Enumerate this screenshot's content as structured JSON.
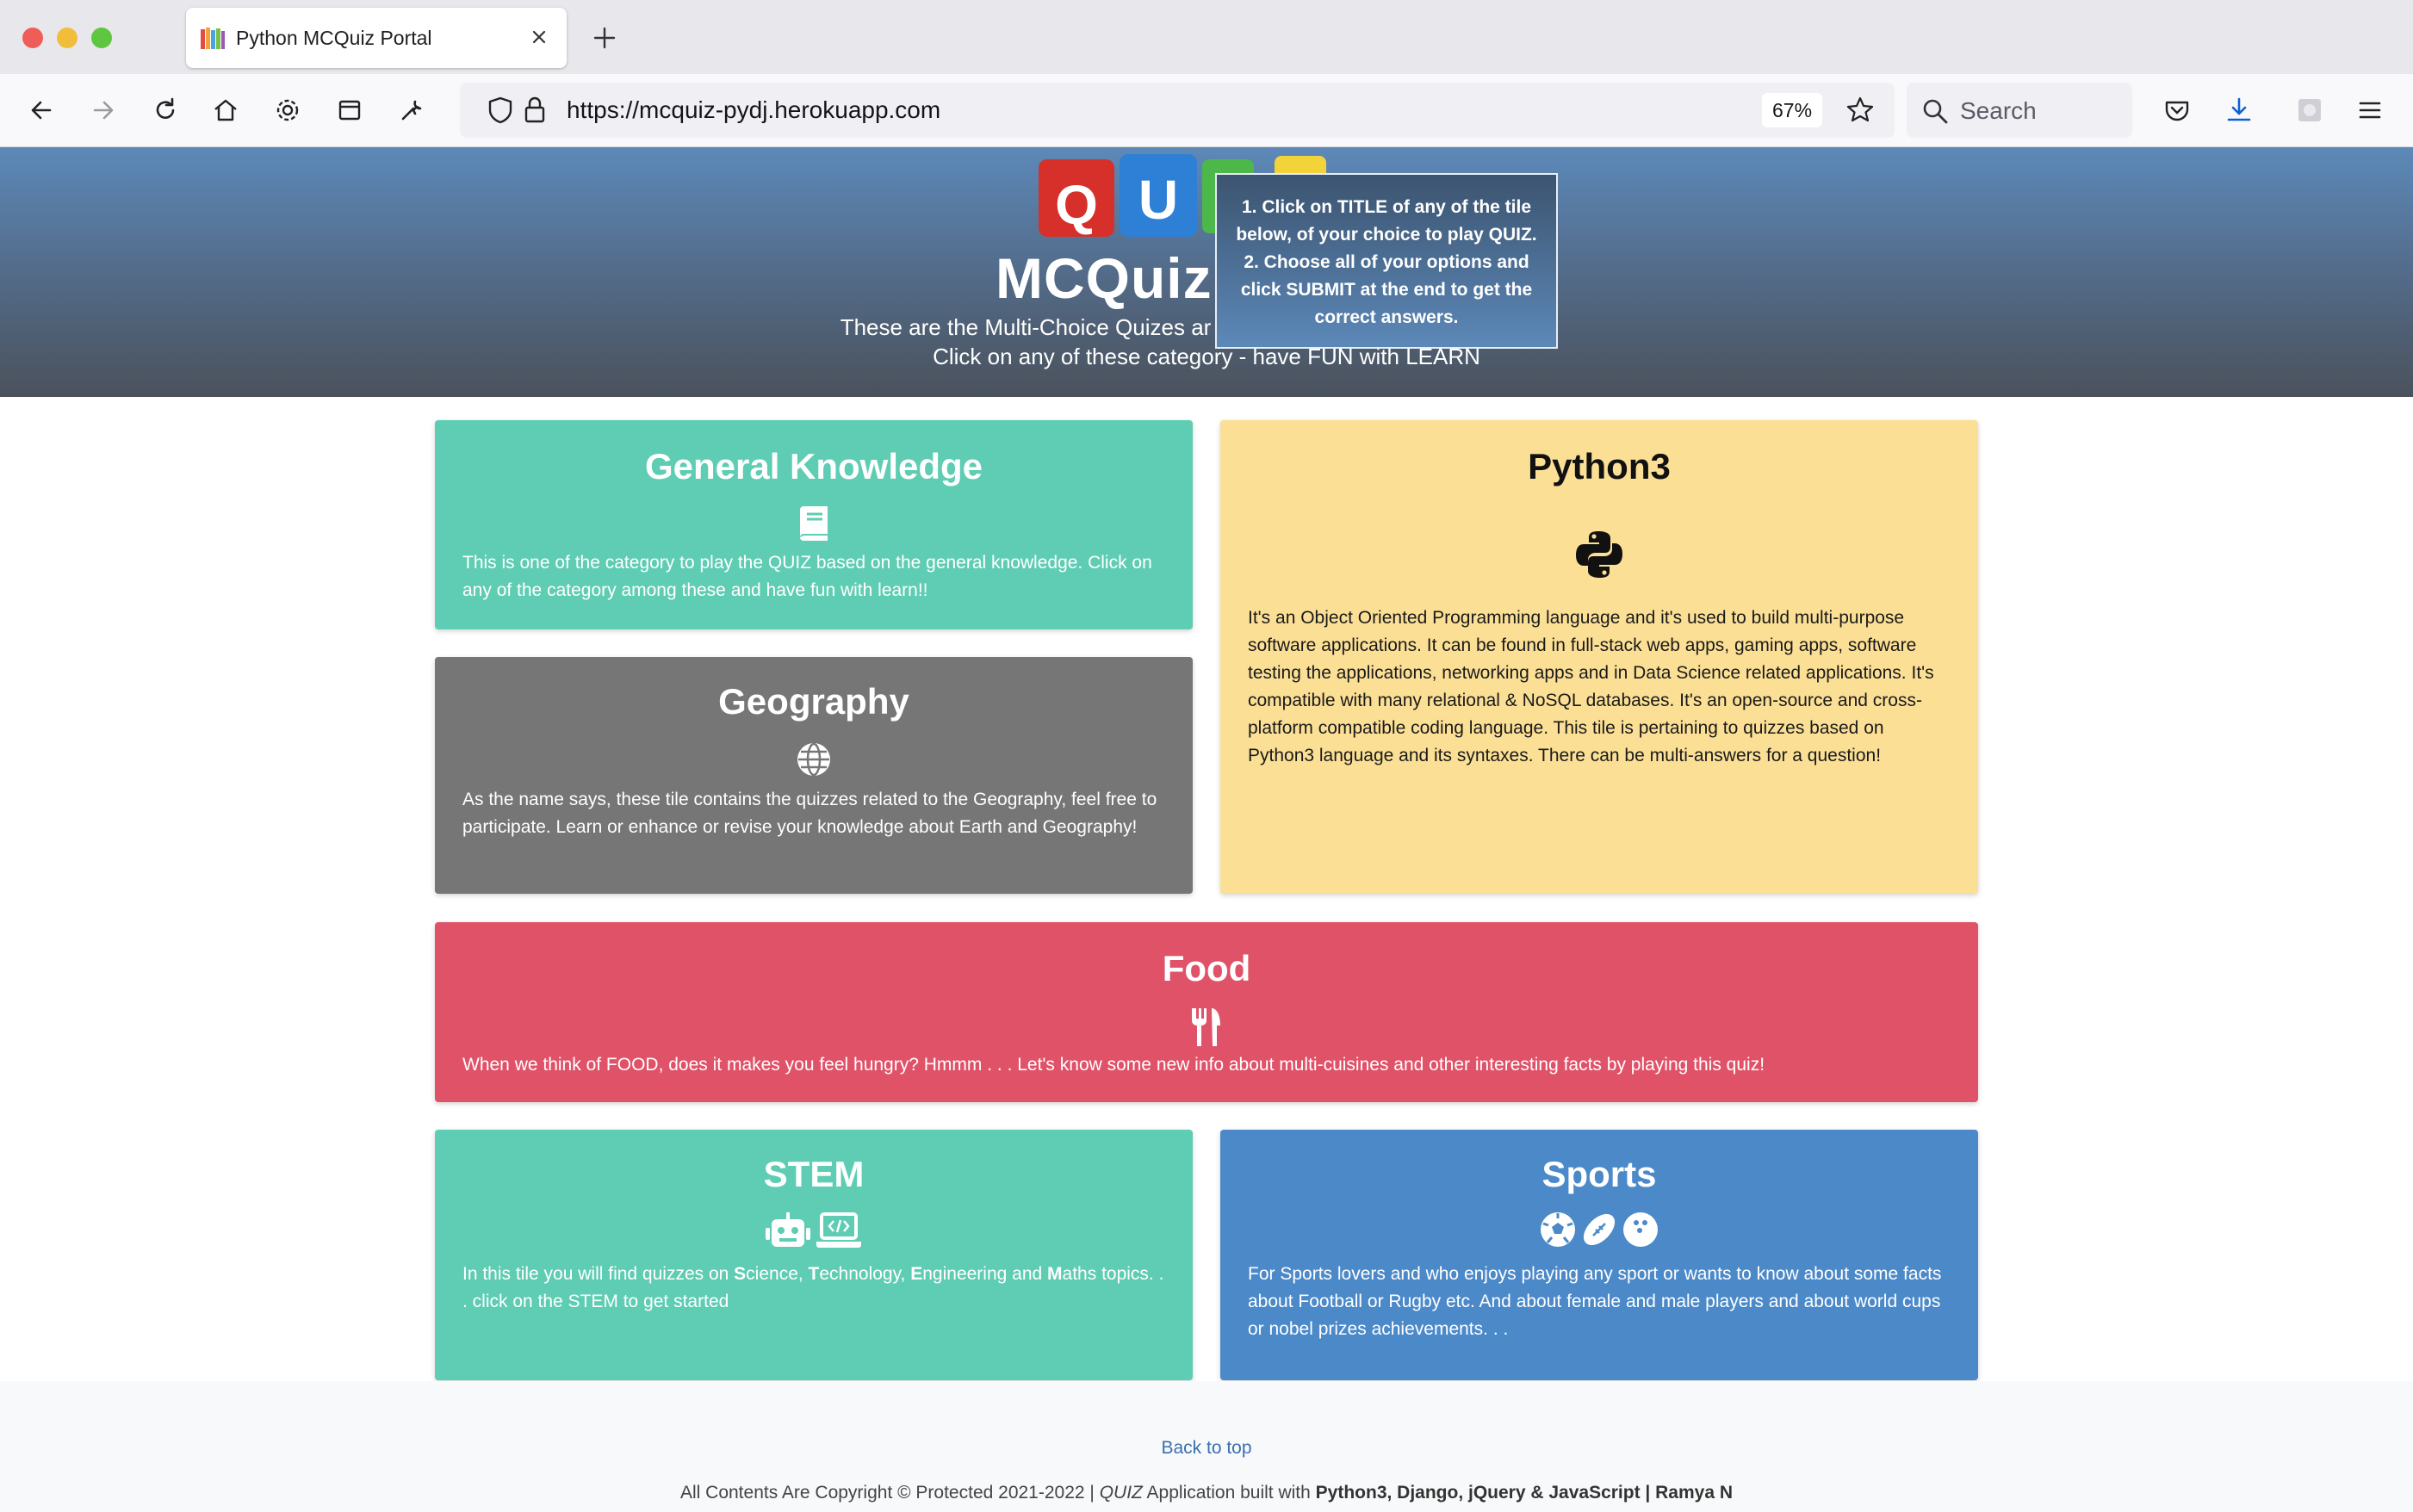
{
  "browser": {
    "tab_title": "Python MCQuiz Portal",
    "url": "https://mcquiz-pydj.herokuapp.com",
    "zoom": "67%",
    "search_placeholder": "Search"
  },
  "hero": {
    "logo_letters": [
      "Q",
      "U"
    ],
    "title": "MCQuiz I",
    "subtitle_line1": "These are the Multi-Choice Quizes ar",
    "subtitle_line2": "Click on any of these category - have FUN with LEARN"
  },
  "tooltip": {
    "line1": "1. Click on TITLE of any of the tile",
    "line2": "below, of your choice to play QUIZ.",
    "line3": "2. Choose all of your options and",
    "line4": "click SUBMIT at the end to get the",
    "line5": "correct answers."
  },
  "tiles": {
    "general_knowledge": {
      "title": "General Knowledge",
      "icon": "book-icon",
      "text": "This is one of the category to play the QUIZ based on the general knowledge. Click on any of the category among these and have fun with learn!!"
    },
    "geography": {
      "title": "Geography",
      "icon": "globe-icon",
      "text": "As the name says, these tile contains the quizzes related to the Geography, feel free to participate. Learn or enhance or revise your knowledge about Earth and Geography!"
    },
    "python3": {
      "title": "Python3",
      "icon": "python-icon",
      "text": "It's an Object Oriented Programming language and it's used to build multi-purpose software applications. It can be found in full-stack web apps, gaming apps, software testing the applications, networking apps and in Data Science related applications. It's compatible with many relational & NoSQL databases. It's an open-source and cross-platform compatible coding language. This tile is pertaining to quizzes based on Python3 language and its syntaxes. There can be multi-answers for a question!"
    },
    "food": {
      "title": "Food",
      "icon": "utensils-icon",
      "text": "When we think of FOOD, does it makes you feel hungry? Hmmm . . . Let's know some new info about multi-cuisines and other interesting facts by playing this quiz!"
    },
    "stem": {
      "title": "STEM",
      "icons": [
        "robot-icon",
        "laptop-code-icon"
      ],
      "text_parts": [
        "In this tile you will find quizzes on ",
        "S",
        "cience, ",
        "T",
        "echnology, ",
        "E",
        "ngineering and ",
        "M",
        "aths topics. . . click on the STEM to get started"
      ]
    },
    "sports": {
      "title": "Sports",
      "icons": [
        "soccer-ball-icon",
        "football-icon",
        "bowling-ball-icon"
      ],
      "text": "For Sports lovers and who enjoys playing any sport or wants to know about some facts about Football or Rugby etc. And about female and male players and about world cups or nobel prizes achievements. . ."
    }
  },
  "footer": {
    "back_to_top": "Back to top",
    "copyright_prefix": "All Contents Are Copyright © Protected 2021-2022 | ",
    "quiz_word": "QUIZ",
    "copyright_mid": " Application built with ",
    "tech": "Python3, Django, jQuery & JavaScript | Ramya N"
  },
  "colors": {
    "teal": "#5ecdb3",
    "grey": "#767676",
    "yellow": "#fbdf95",
    "red": "#e05268",
    "blue": "#4b89c9"
  }
}
